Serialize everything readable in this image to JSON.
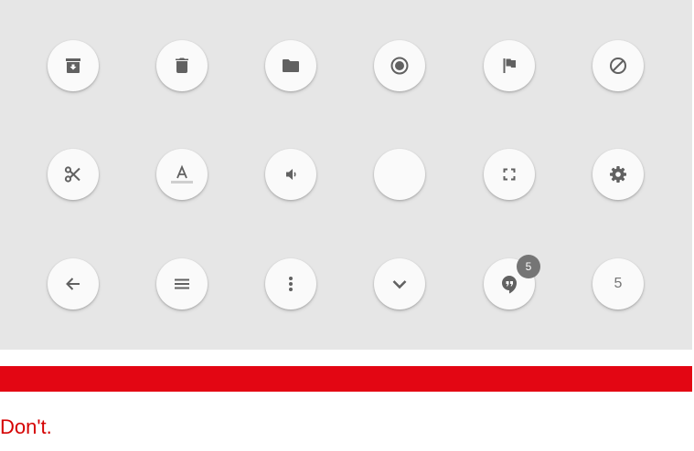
{
  "buttons": {
    "row1": [
      {
        "name": "archive-button",
        "icon": "archive-icon"
      },
      {
        "name": "delete-button",
        "icon": "trash-icon"
      },
      {
        "name": "folder-button",
        "icon": "folder-icon"
      },
      {
        "name": "record-button",
        "icon": "radio-record-icon"
      },
      {
        "name": "flag-button",
        "icon": "flag-icon"
      },
      {
        "name": "block-button",
        "icon": "block-icon"
      }
    ],
    "row2": [
      {
        "name": "cut-button",
        "icon": "scissors-icon"
      },
      {
        "name": "text-color-button",
        "icon": "format-color-text-icon"
      },
      {
        "name": "volume-button",
        "icon": "volume-icon"
      },
      {
        "name": "empty-button",
        "icon": ""
      },
      {
        "name": "fullscreen-button",
        "icon": "fullscreen-icon"
      },
      {
        "name": "settings-button",
        "icon": "gear-icon"
      }
    ],
    "row3": [
      {
        "name": "back-button",
        "icon": "arrow-back-icon"
      },
      {
        "name": "menu-button",
        "icon": "menu-icon"
      },
      {
        "name": "more-button",
        "icon": "more-vertical-icon"
      },
      {
        "name": "expand-button",
        "icon": "chevron-down-icon"
      },
      {
        "name": "hangouts-button",
        "icon": "hangouts-icon",
        "badge": "5"
      },
      {
        "name": "number-button",
        "label": "5"
      }
    ]
  },
  "colors": {
    "panel_bg": "#e6e6e6",
    "button_bg": "#fafafa",
    "icon": "#616161",
    "badge_bg": "#757575",
    "accent_red": "#e30613",
    "caption": "#d50000"
  },
  "caption": "Don't."
}
